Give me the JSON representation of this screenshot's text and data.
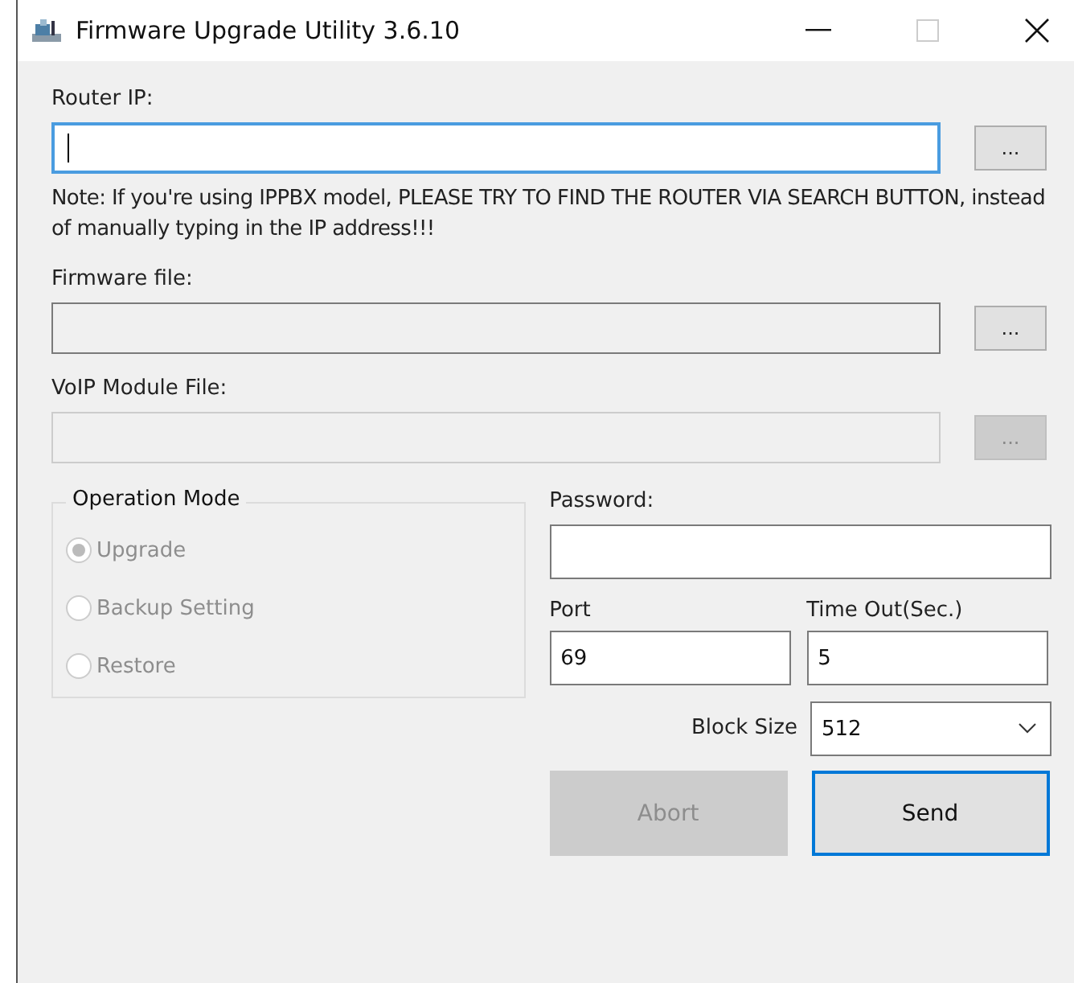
{
  "window": {
    "title": "Firmware Upgrade Utility 3.6.10"
  },
  "router_ip": {
    "label": "Router IP:",
    "focused": true,
    "browse": {
      "label": "...",
      "disabled": false
    }
  },
  "note": "Note: If you're using IPPBX model, PLEASE TRY TO FIND THE ROUTER VIA SEARCH BUTTON, instead of manually typing in the IP address!!!",
  "firmware_file": {
    "label": "Firmware file:",
    "disabled": false,
    "browse": {
      "label": "...",
      "disabled": false
    }
  },
  "voip_module_file": {
    "label": "VoIP Module File:",
    "disabled": true,
    "browse": {
      "label": "...",
      "disabled": true
    }
  },
  "operation_mode": {
    "title": "Operation Mode",
    "options": [
      {
        "label": "Upgrade",
        "selected": true,
        "disabled": true
      },
      {
        "label": "Backup Setting",
        "selected": false,
        "disabled": true
      },
      {
        "label": "Restore",
        "selected": false,
        "disabled": true
      }
    ]
  },
  "password": {
    "label": "Password:"
  },
  "port": {
    "label": "Port",
    "value": "69"
  },
  "timeout": {
    "label": "Time Out(Sec.)",
    "value": "5"
  },
  "block_size": {
    "label": "Block Size",
    "value": "512"
  },
  "buttons": [
    {
      "label": "Abort",
      "disabled": true,
      "default": false
    },
    {
      "label": "Send",
      "disabled": false,
      "default": true
    }
  ]
}
